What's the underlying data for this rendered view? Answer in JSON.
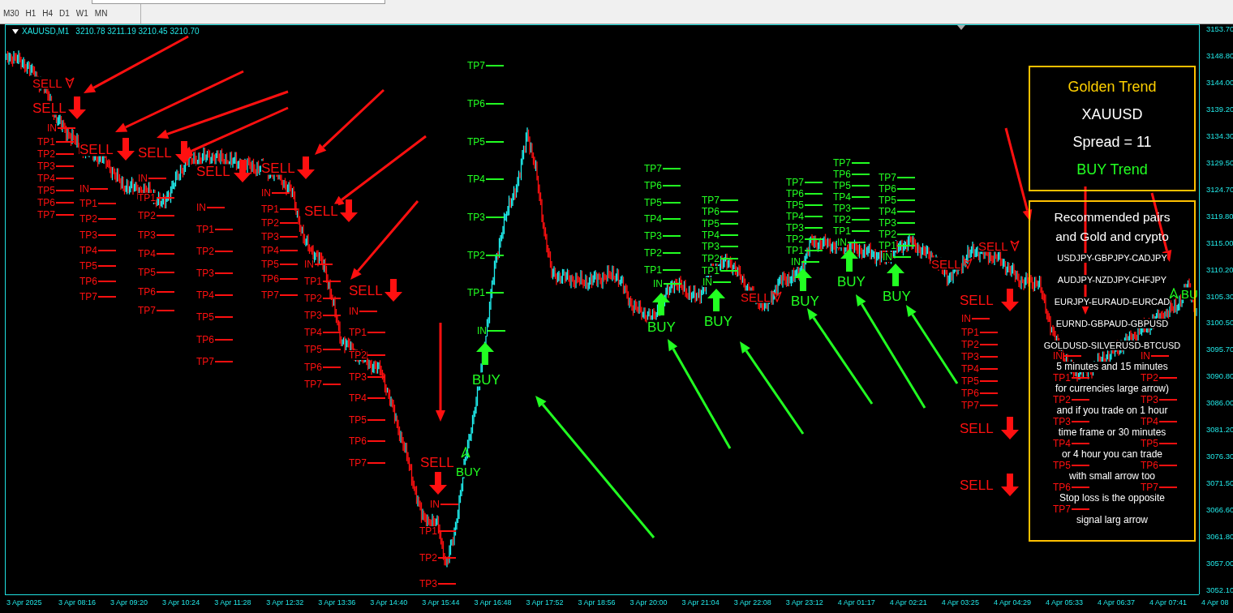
{
  "toolbar": {
    "timeframes": [
      "M30",
      "H1",
      "H4",
      "D1",
      "W1",
      "MN"
    ]
  },
  "chart": {
    "symbol": "XAUUSD,M1",
    "ohlc": "3210.78 3211.19 3210.45 3210.70",
    "price_axis": [
      "3153.70",
      "3148.80",
      "3144.00",
      "3139.20",
      "3134.30",
      "3129.50",
      "3124.70",
      "3119.80",
      "3115.00",
      "3110.20",
      "3105.30",
      "3100.50",
      "3095.70",
      "3090.80",
      "3086.00",
      "3081.20",
      "3076.30",
      "3071.50",
      "3066.60",
      "3061.80",
      "3057.00",
      "3052.10"
    ],
    "time_axis": [
      "3 Apr 2025",
      "3 Apr 08:16",
      "3 Apr 09:20",
      "3 Apr 10:24",
      "3 Apr 11:28",
      "3 Apr 12:32",
      "3 Apr 13:36",
      "3 Apr 14:40",
      "3 Apr 15:44",
      "3 Apr 16:48",
      "3 Apr 17:52",
      "3 Apr 18:56",
      "3 Apr 20:00",
      "3 Apr 21:04",
      "3 Apr 22:08",
      "3 Apr 23:12",
      "4 Apr 01:17",
      "4 Apr 02:21",
      "4 Apr 03:25",
      "4 Apr 04:29",
      "4 Apr 05:33",
      "4 Apr 06:37",
      "4 Apr 07:41",
      "4 Apr 08"
    ],
    "signals": [
      {
        "kind": "sell",
        "label": "SELL",
        "entry": "IN",
        "targets": [
          "TP1",
          "TP2",
          "TP3",
          "TP4",
          "TP5",
          "TP6",
          "TP7"
        ]
      },
      {
        "kind": "sell",
        "label": "SELL",
        "entry": "IN",
        "targets": [
          "TP1",
          "TP2",
          "TP3",
          "TP4",
          "TP5",
          "TP6",
          "TP7"
        ]
      },
      {
        "kind": "sell",
        "label": "SELL",
        "entry": "IN",
        "targets": [
          "TP1",
          "TP2",
          "TP3",
          "TP4",
          "TP5",
          "TP6",
          "TP7"
        ]
      },
      {
        "kind": "sell",
        "label": "SELL",
        "entry": "IN",
        "targets": [
          "TP1",
          "TP2",
          "TP3",
          "TP4",
          "TP5",
          "TP6",
          "TP7"
        ]
      },
      {
        "kind": "sell",
        "label": "SELL",
        "entry": "IN",
        "targets": [
          "TP1",
          "TP2",
          "TP3",
          "TP4",
          "TP5",
          "TP6",
          "TP7"
        ]
      },
      {
        "kind": "sell",
        "label": "SELL",
        "entry": "IN",
        "targets": [
          "TP1",
          "TP2",
          "TP3",
          "TP4",
          "TP5",
          "TP6",
          "TP7"
        ]
      },
      {
        "kind": "sell",
        "label": "SELL",
        "entry": "IN",
        "targets": [
          "TP1",
          "TP2",
          "TP3",
          "TP4",
          "TP5",
          "TP6",
          "TP7"
        ]
      },
      {
        "kind": "sell",
        "label": "SELL",
        "entry": "IN",
        "targets": [
          "TP1",
          "TP2",
          "TP3"
        ]
      },
      {
        "kind": "buy",
        "label": "BUY",
        "entry": "IN",
        "targets": [
          "TP7",
          "TP6",
          "TP5",
          "TP4",
          "TP3",
          "TP2",
          "TP1"
        ]
      },
      {
        "kind": "buy",
        "label": "BUY",
        "entry": "IN",
        "targets": [
          "TP7",
          "TP6",
          "TP5",
          "TP4",
          "TP3",
          "TP2",
          "TP1"
        ]
      },
      {
        "kind": "buy",
        "label": "BUY",
        "entry": "IN",
        "targets": [
          "TP7",
          "TP6",
          "TP5",
          "TP4",
          "TP3",
          "TP2",
          "TP1"
        ]
      },
      {
        "kind": "buy",
        "label": "BUY",
        "entry": "IN",
        "targets": [
          "TP7",
          "TP6",
          "TP5",
          "TP4",
          "TP3",
          "TP2",
          "TP1"
        ]
      },
      {
        "kind": "buy",
        "label": "BUY",
        "entry": "IN",
        "targets": [
          "TP7",
          "TP6",
          "TP5",
          "TP4",
          "TP3",
          "TP2",
          "TP1"
        ]
      },
      {
        "kind": "buy",
        "label": "BUY",
        "entry": "IN",
        "targets": [
          "TP7",
          "TP6",
          "TP5",
          "TP4",
          "TP3",
          "TP2",
          "TP1"
        ]
      },
      {
        "kind": "sell",
        "label": "SELL",
        "entry": "IN",
        "targets": [
          "TP1",
          "TP2",
          "TP3",
          "TP4",
          "TP5",
          "TP6",
          "TP7"
        ]
      },
      {
        "kind": "sell",
        "label": "SELL",
        "entry": "IN",
        "targets": [
          "TP1",
          "TP2",
          "TP3",
          "TP4",
          "TP5",
          "TP6",
          "TP7"
        ]
      },
      {
        "kind": "sell",
        "label": "SELL",
        "entry": "IN",
        "targets": [
          "TP2",
          "TP3",
          "TP4",
          "TP5",
          "TP6",
          "TP7"
        ]
      }
    ],
    "markers": [
      {
        "kind": "sell",
        "label": "SELL"
      },
      {
        "kind": "buy",
        "label": "BUY"
      },
      {
        "kind": "sell",
        "label": "SELL"
      },
      {
        "kind": "sell",
        "label": "SELL"
      },
      {
        "kind": "sell",
        "label": "SELL"
      },
      {
        "kind": "buy",
        "label": "BU"
      }
    ],
    "info_panel": {
      "title": "Golden Trend",
      "symbol": "XAUUSD",
      "spread": "Spread = 11",
      "trend": "BUY Trend"
    },
    "notes_panel": {
      "heading": [
        "Recommended pairs",
        "and Gold and crypto"
      ],
      "pairs": [
        "USDJPY-GBPJPY-CADJPY",
        "AUDJPY-NZDJPY-CHFJPY",
        "EURJPY-EURAUD-EURCAD",
        "EURND-GBPAUD-GBPUSD",
        "GOLDUSD-SILVERUSD-BTCUSD"
      ],
      "lines": [
        "5 minutes and 15 minutes",
        "for currencies large arrow)",
        "and if you trade on 1 hour",
        "time frame or 30 minutes",
        "or 4 hour you can trade",
        "with small arrow too",
        "Stop loss is the opposite",
        "signal larg arrow"
      ]
    }
  }
}
